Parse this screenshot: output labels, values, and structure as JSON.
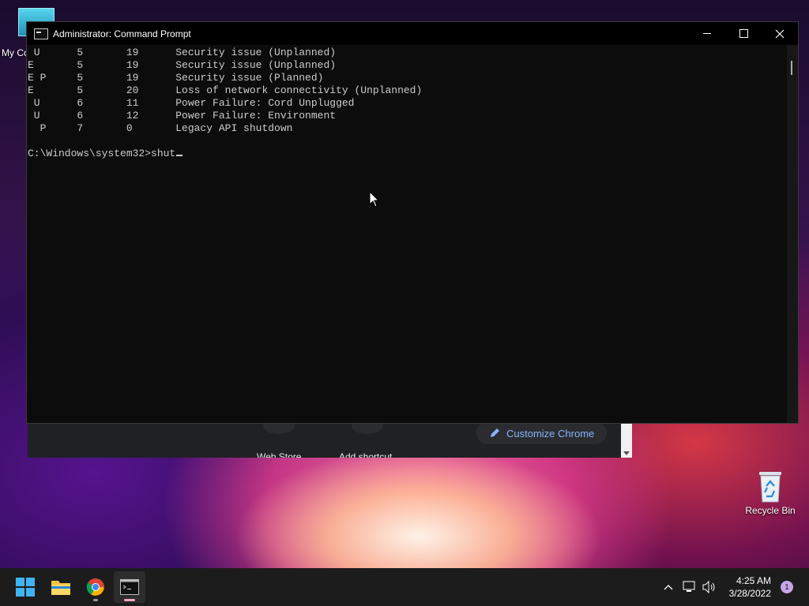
{
  "desktop": {
    "my_computer_label": "My Co",
    "recycle_bin_label": "Recycle Bin"
  },
  "chrome_window": {
    "shortcut_1_label": "Web Store",
    "shortcut_2_label": "Add shortcut",
    "customize_label": "Customize Chrome"
  },
  "cmd": {
    "title": "Administrator: Command Prompt",
    "lines": [
      " U      5       19      Security issue (Unplanned)",
      "E       5       19      Security issue (Unplanned)",
      "E P     5       19      Security issue (Planned)",
      "E       5       20      Loss of network connectivity (Unplanned)",
      " U      6       11      Power Failure: Cord Unplugged",
      " U      6       12      Power Failure: Environment",
      "  P     7       0       Legacy API shutdown",
      "",
      "C:\\Windows\\system32>shut"
    ]
  },
  "taskbar": {
    "apps": [
      "start-icon",
      "file-explorer-icon",
      "chrome-icon",
      "command-prompt-icon"
    ],
    "time": "4:25 AM",
    "date": "3/28/2022",
    "notification_count": "1"
  },
  "colors": {
    "console_bg": "#0c0c0c",
    "console_text": "#cccccc",
    "taskbar_bg": "#1c1c1c",
    "accent_pink": "#f6a2c5",
    "chrome_link": "#8ab4f8"
  }
}
